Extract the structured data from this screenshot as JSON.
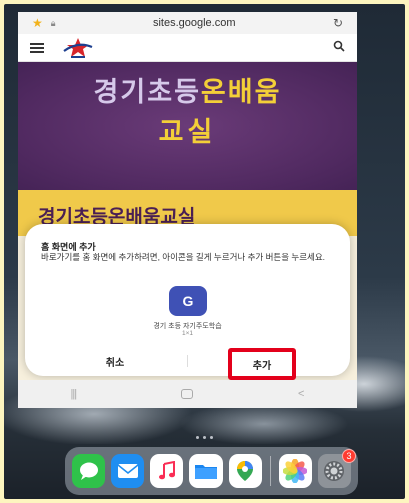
{
  "browser": {
    "url": "sites.google.com"
  },
  "banner": {
    "line1_part1": "경기초등",
    "line1_part2": "온배움",
    "line2": "교실"
  },
  "page_heading": "경기초등온배움교실",
  "dialog": {
    "title": "홈 화면에 추가",
    "text": "바로가기를 홈 화면에 추가하려면, 아이콘을 길게 누르거나 추가 버튼을 누르세요.",
    "icon_letter": "G",
    "app_name": "경기 초등 자기주도학습",
    "app_size": "1×1",
    "cancel_label": "취소",
    "add_label": "추가"
  },
  "android_nav": {
    "recent": "|||",
    "back": "<"
  },
  "dock": {
    "photos_badge": "3",
    "apps": [
      "messages-icon",
      "mail-icon",
      "music-icon",
      "files-icon",
      "maps-icon",
      "photos-icon",
      "settings-icon"
    ]
  },
  "colors": {
    "banner_purple": "#512a61",
    "banner_gold": "#f3cf38",
    "heading_strip": "#f0c94a",
    "highlight_red": "#e3001b",
    "g_icon_blue": "#3f51b5"
  }
}
